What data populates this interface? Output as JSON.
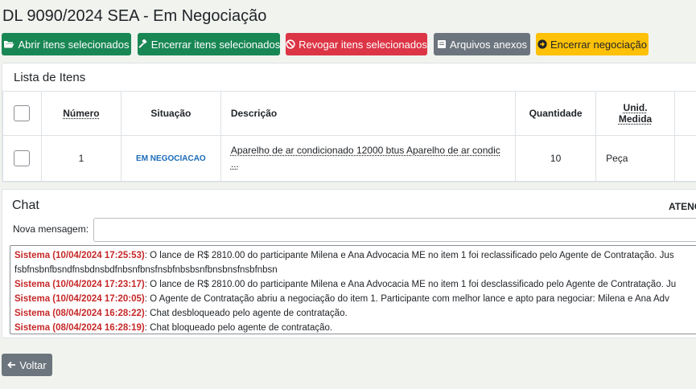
{
  "page": {
    "title": "DL 9090/2024 SEA - Em Negociação"
  },
  "toolbar": {
    "open_label": "Abrir itens selecionados",
    "close_label": "Encerrar itens selecionados",
    "revoke_label": "Revogar itens selecionados",
    "files_label": "Arquivos anexos",
    "end_negotiation_label": "Encerrar negociação"
  },
  "items": {
    "title": "Lista de Itens",
    "columns": {
      "numero": "Número",
      "situacao": "Situação",
      "descricao": "Descrição",
      "quantidade": "Quantidade",
      "unid_line1": "Unid.",
      "unid_line2": "Medida"
    },
    "rows": [
      {
        "numero": "1",
        "situacao": "EM NEGOCIACAO",
        "descricao": "Aparelho de ar condicionado 12000 btus Aparelho de ar condic",
        "descricao_more": "...",
        "quantidade": "10",
        "unidade": "Peça"
      }
    ]
  },
  "chat": {
    "title": "Chat",
    "attention": "ATENÇ",
    "input_label": "Nova mensagem:",
    "input_placeholder": "",
    "messages": [
      {
        "sender": "Sistema (10/04/2024 17:25:53)",
        "text": ": O lance de R$ 2810.00 do participante Milena e Ana Advocacia ME no item 1 foi reclassificado pelo Agente de Contratação. Jus"
      },
      {
        "sender": "",
        "text": "fsbfnsbnfbsndfnsbdnsbdfnbsnfbnsfnsbfnbsbsnfbnsbnsfnsbfnbsn"
      },
      {
        "sender": "Sistema (10/04/2024 17:23:17)",
        "text": ": O lance de R$ 2810.00 do participante Milena e Ana Advocacia ME no item 1 foi desclassificado pelo Agente de Contratação. Ju"
      },
      {
        "sender": "Sistema (10/04/2024 17:20:05)",
        "text": ": O Agente de Contratação abriu a negociação do item 1. Participante com melhor lance e apto para negociar: Milena e Ana Adv"
      },
      {
        "sender": "Sistema (08/04/2024 16:28:22)",
        "text": ": Chat desbloqueado pelo agente de contratação."
      },
      {
        "sender": "Sistema (08/04/2024 16:28:19)",
        "text": ": Chat bloqueado pelo agente de contratação."
      }
    ]
  },
  "footer": {
    "back_label": "Voltar"
  },
  "colors": {
    "green": "#198754",
    "red": "#dc3545",
    "gray": "#6c757d",
    "yellow": "#ffc107",
    "status_blue": "#1a6bb8",
    "sender_red": "#c62828"
  }
}
